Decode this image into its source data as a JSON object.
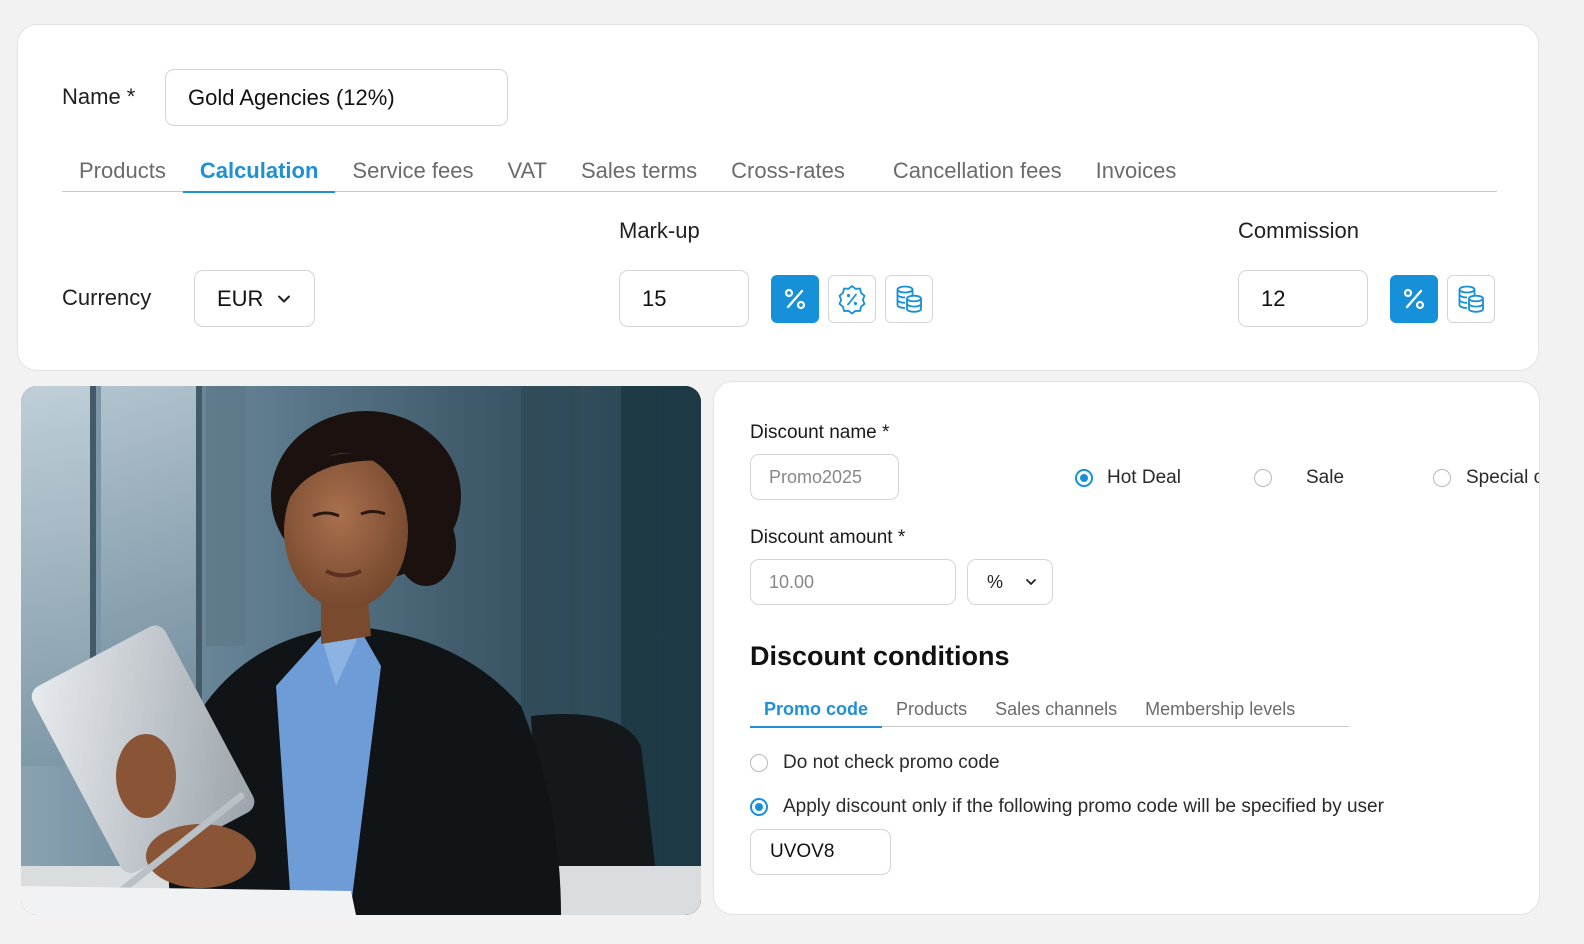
{
  "form": {
    "name_label": "Name *",
    "name_value": "Gold Agencies (12%)",
    "tabs": [
      {
        "label": "Products",
        "active": false
      },
      {
        "label": "Calculation",
        "active": true
      },
      {
        "label": "Service fees",
        "active": false
      },
      {
        "label": "VAT",
        "active": false
      },
      {
        "label": "Sales terms",
        "active": false
      },
      {
        "label": "Cross-rates",
        "active": false
      },
      {
        "label": "Cancellation fees",
        "active": false
      },
      {
        "label": "Invoices",
        "active": false
      }
    ],
    "currency_label": "Currency",
    "currency_value": "EUR",
    "markup_label": "Mark-up",
    "markup_value": "15",
    "commission_label": "Commission",
    "commission_value": "12"
  },
  "discount": {
    "name_label": "Discount name *",
    "name_placeholder": "Promo2025",
    "types": [
      {
        "label": "Hot Deal",
        "selected": true
      },
      {
        "label": "Sale",
        "selected": false
      },
      {
        "label": "Special of",
        "selected": false
      }
    ],
    "amount_label": "Discount amount *",
    "amount_placeholder": "10.00",
    "unit_value": "%",
    "conditions_title": "Discount conditions",
    "condition_tabs": [
      {
        "label": "Promo code",
        "active": true
      },
      {
        "label": "Products",
        "active": false
      },
      {
        "label": "Sales channels",
        "active": false
      },
      {
        "label": "Membership levels",
        "active": false
      }
    ],
    "option_no_check": "Do not check promo code",
    "option_apply": "Apply discount only if the following promo code will be specified by user",
    "promo_code_value": "UVOV8"
  },
  "colors": {
    "accent": "#1690d8",
    "border": "#d5d5d5",
    "page_bg": "#f2f2f2"
  },
  "icons": [
    "percent-icon",
    "discount-badge-icon",
    "coins-stack-icon",
    "chevron-down-icon"
  ]
}
